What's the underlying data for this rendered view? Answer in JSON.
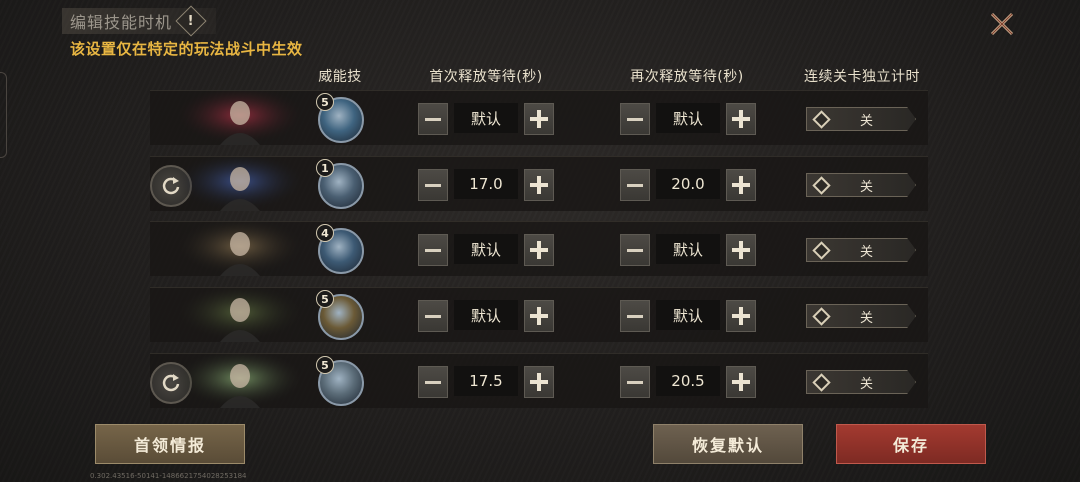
{
  "header": {
    "title": "编辑技能时机",
    "warning_icon": "exclamation-icon",
    "note": "该设置仅在特定的玩法战斗中生效"
  },
  "columns": {
    "skill": "威能技",
    "first_wait": "首次释放等待(秒)",
    "repeat_wait": "再次释放等待(秒)",
    "independent_timer": "连续关卡独立计时"
  },
  "rows": [
    {
      "skill_level": "5",
      "first_wait": "默认",
      "repeat_wait": "默认",
      "timer": "关",
      "has_reset": false,
      "skill_color": "#3f6480",
      "portrait_color": "#8a2b3a"
    },
    {
      "skill_level": "1",
      "first_wait": "17.0",
      "repeat_wait": "20.0",
      "timer": "关",
      "has_reset": true,
      "skill_color": "#4a5f72",
      "portrait_color": "#3a4e86"
    },
    {
      "skill_level": "4",
      "first_wait": "默认",
      "repeat_wait": "默认",
      "timer": "关",
      "has_reset": false,
      "skill_color": "#3d5a74",
      "portrait_color": "#6b5a40"
    },
    {
      "skill_level": "5",
      "first_wait": "默认",
      "repeat_wait": "默认",
      "timer": "关",
      "has_reset": false,
      "skill_color": "#6b5a36",
      "portrait_color": "#4e5a36"
    },
    {
      "skill_level": "5",
      "first_wait": "17.5",
      "repeat_wait": "20.5",
      "timer": "关",
      "has_reset": true,
      "skill_color": "#5b6c78",
      "portrait_color": "#6f8a5e"
    }
  ],
  "buttons": {
    "intel": "首领情报",
    "restore": "恢复默认",
    "save": "保存"
  },
  "version": "0.302.43516-50141-1486621754028253184",
  "colors": {
    "accent": "#e8b642",
    "save": "#8f3128"
  }
}
